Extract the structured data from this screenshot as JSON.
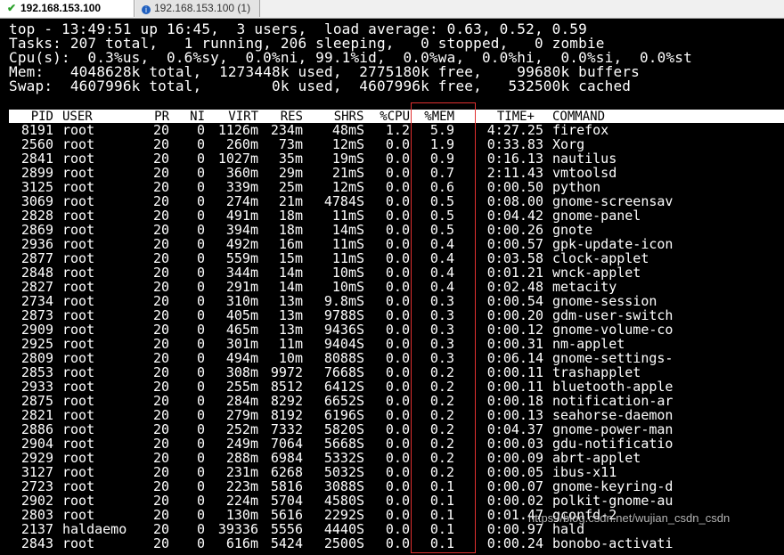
{
  "tabs": [
    {
      "label": "192.168.153.100",
      "icon": "check-icon",
      "active": true
    },
    {
      "label": "192.168.153.100 (1)",
      "icon": "info-icon",
      "active": false
    }
  ],
  "summary": [
    "top - 13:49:51 up 16:45,  3 users,  load average: 0.63, 0.52, 0.59",
    "Tasks: 207 total,   1 running, 206 sleeping,   0 stopped,   0 zombie",
    "Cpu(s):  0.3%us,  0.6%sy,  0.0%ni, 99.1%id,  0.0%wa,  0.0%hi,  0.0%si,  0.0%st",
    "Mem:   4048628k total,  1273448k used,  2775180k free,    99680k buffers",
    "Swap:  4607996k total,        0k used,  4607996k free,   532500k cached"
  ],
  "columns": [
    "PID",
    "USER",
    "PR",
    "NI",
    "VIRT",
    "RES",
    "SHR",
    "S",
    "%CPU",
    "%MEM",
    "TIME+",
    "COMMAND"
  ],
  "processes": [
    [
      "8191",
      "root",
      "20",
      "0",
      "1126m",
      "234m",
      "48m",
      "S",
      "1.2",
      "5.9",
      "4:27.25",
      "firefox"
    ],
    [
      "2560",
      "root",
      "20",
      "0",
      "260m",
      "73m",
      "12m",
      "S",
      "0.0",
      "1.9",
      "0:33.83",
      "Xorg"
    ],
    [
      "2841",
      "root",
      "20",
      "0",
      "1027m",
      "35m",
      "19m",
      "S",
      "0.0",
      "0.9",
      "0:16.13",
      "nautilus"
    ],
    [
      "2899",
      "root",
      "20",
      "0",
      "360m",
      "29m",
      "21m",
      "S",
      "0.0",
      "0.7",
      "2:11.43",
      "vmtoolsd"
    ],
    [
      "3125",
      "root",
      "20",
      "0",
      "339m",
      "25m",
      "12m",
      "S",
      "0.0",
      "0.6",
      "0:00.50",
      "python"
    ],
    [
      "3069",
      "root",
      "20",
      "0",
      "274m",
      "21m",
      "4784",
      "S",
      "0.0",
      "0.5",
      "0:08.00",
      "gnome-screensav"
    ],
    [
      "2828",
      "root",
      "20",
      "0",
      "491m",
      "18m",
      "11m",
      "S",
      "0.0",
      "0.5",
      "0:04.42",
      "gnome-panel"
    ],
    [
      "2869",
      "root",
      "20",
      "0",
      "394m",
      "18m",
      "14m",
      "S",
      "0.0",
      "0.5",
      "0:00.26",
      "gnote"
    ],
    [
      "2936",
      "root",
      "20",
      "0",
      "492m",
      "16m",
      "11m",
      "S",
      "0.0",
      "0.4",
      "0:00.57",
      "gpk-update-icon"
    ],
    [
      "2877",
      "root",
      "20",
      "0",
      "559m",
      "15m",
      "11m",
      "S",
      "0.0",
      "0.4",
      "0:03.58",
      "clock-applet"
    ],
    [
      "2848",
      "root",
      "20",
      "0",
      "344m",
      "14m",
      "10m",
      "S",
      "0.0",
      "0.4",
      "0:01.21",
      "wnck-applet"
    ],
    [
      "2827",
      "root",
      "20",
      "0",
      "291m",
      "14m",
      "10m",
      "S",
      "0.0",
      "0.4",
      "0:02.48",
      "metacity"
    ],
    [
      "2734",
      "root",
      "20",
      "0",
      "310m",
      "13m",
      "9.8m",
      "S",
      "0.0",
      "0.3",
      "0:00.54",
      "gnome-session"
    ],
    [
      "2873",
      "root",
      "20",
      "0",
      "405m",
      "13m",
      "9788",
      "S",
      "0.0",
      "0.3",
      "0:00.20",
      "gdm-user-switch"
    ],
    [
      "2909",
      "root",
      "20",
      "0",
      "465m",
      "13m",
      "9436",
      "S",
      "0.0",
      "0.3",
      "0:00.12",
      "gnome-volume-co"
    ],
    [
      "2925",
      "root",
      "20",
      "0",
      "301m",
      "11m",
      "9404",
      "S",
      "0.0",
      "0.3",
      "0:00.31",
      "nm-applet"
    ],
    [
      "2809",
      "root",
      "20",
      "0",
      "494m",
      "10m",
      "8088",
      "S",
      "0.0",
      "0.3",
      "0:06.14",
      "gnome-settings-"
    ],
    [
      "2853",
      "root",
      "20",
      "0",
      "308m",
      "9972",
      "7668",
      "S",
      "0.0",
      "0.2",
      "0:00.11",
      "trashapplet"
    ],
    [
      "2933",
      "root",
      "20",
      "0",
      "255m",
      "8512",
      "6412",
      "S",
      "0.0",
      "0.2",
      "0:00.11",
      "bluetooth-apple"
    ],
    [
      "2875",
      "root",
      "20",
      "0",
      "284m",
      "8292",
      "6652",
      "S",
      "0.0",
      "0.2",
      "0:00.18",
      "notification-ar"
    ],
    [
      "2821",
      "root",
      "20",
      "0",
      "279m",
      "8192",
      "6196",
      "S",
      "0.0",
      "0.2",
      "0:00.13",
      "seahorse-daemon"
    ],
    [
      "2886",
      "root",
      "20",
      "0",
      "252m",
      "7332",
      "5820",
      "S",
      "0.0",
      "0.2",
      "0:04.37",
      "gnome-power-man"
    ],
    [
      "2904",
      "root",
      "20",
      "0",
      "249m",
      "7064",
      "5668",
      "S",
      "0.0",
      "0.2",
      "0:00.03",
      "gdu-notificatio"
    ],
    [
      "2929",
      "root",
      "20",
      "0",
      "288m",
      "6984",
      "5332",
      "S",
      "0.0",
      "0.2",
      "0:00.09",
      "abrt-applet"
    ],
    [
      "3127",
      "root",
      "20",
      "0",
      "231m",
      "6268",
      "5032",
      "S",
      "0.0",
      "0.2",
      "0:00.05",
      "ibus-x11"
    ],
    [
      "2723",
      "root",
      "20",
      "0",
      "223m",
      "5816",
      "3088",
      "S",
      "0.0",
      "0.1",
      "0:00.07",
      "gnome-keyring-d"
    ],
    [
      "2902",
      "root",
      "20",
      "0",
      "224m",
      "5704",
      "4580",
      "S",
      "0.0",
      "0.1",
      "0:00.02",
      "polkit-gnome-au"
    ],
    [
      "2803",
      "root",
      "20",
      "0",
      "130m",
      "5616",
      "2292",
      "S",
      "0.0",
      "0.1",
      "0:01.47",
      "gconfd-2"
    ],
    [
      "2137",
      "haldaemo",
      "20",
      "0",
      "39336",
      "5556",
      "4440",
      "S",
      "0.0",
      "0.1",
      "0:00.97",
      "hald"
    ],
    [
      "2843",
      "root",
      "20",
      "0",
      "616m",
      "5424",
      "2500",
      "S",
      "0.0",
      "0.1",
      "0:00.24",
      "bonobo-activati"
    ]
  ],
  "watermark": "https://blog.csdn.net/wujian_csdn_csdn",
  "colors": {
    "terminal_bg": "#000000",
    "terminal_fg": "#ffffff",
    "highlight": "#e03030"
  }
}
